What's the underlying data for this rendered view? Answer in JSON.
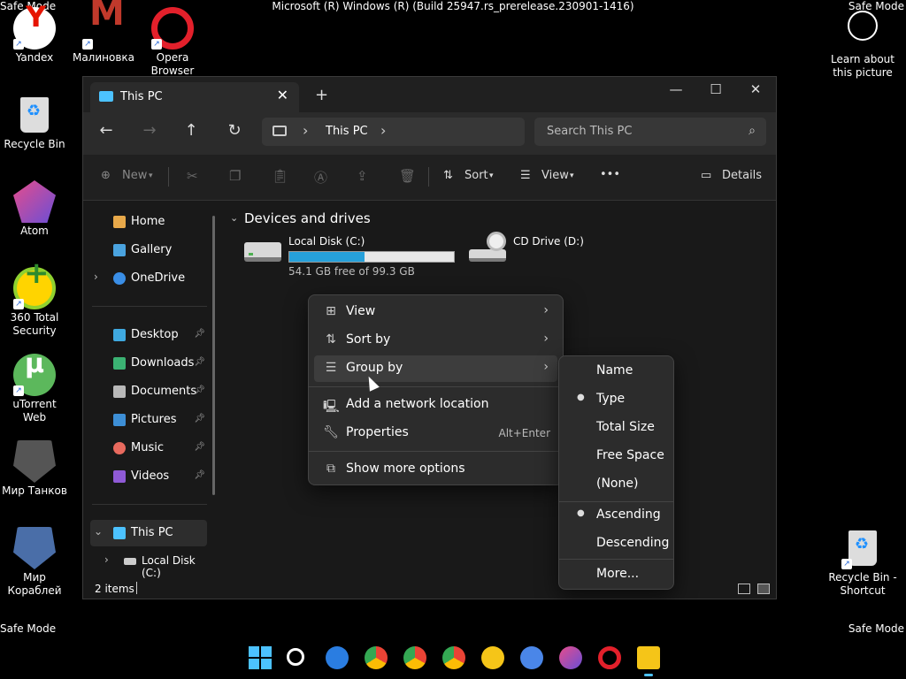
{
  "system": {
    "safe_mode_label": "Safe Mode",
    "build_string": "Microsoft (R) Windows (R) (Build 25947.rs_prerelease.230901-1416)"
  },
  "desktop_icons": [
    {
      "label": "Yandex",
      "icon": "yandex-icon",
      "color": "#ffffff"
    },
    {
      "label": "Малиновка",
      "icon": "malinovka-icon",
      "color": "#c0392b"
    },
    {
      "label": "Opera Browser",
      "icon": "opera-icon",
      "color": "#e3202b"
    },
    {
      "label": "Recycle Bin",
      "icon": "recycle-bin-icon",
      "color": "#c9c9c9"
    },
    {
      "label": "Atom",
      "icon": "atom-icon",
      "color": "#9b59d0"
    },
    {
      "label": "360 Total Security",
      "icon": "360-security-icon",
      "color": "#8fd12f"
    },
    {
      "label": "uTorrent Web",
      "icon": "utorrent-icon",
      "color": "#5cb85c"
    },
    {
      "label": "Мир Танков",
      "icon": "mir-tankov-icon",
      "color": "#777777"
    },
    {
      "label": "Мир Кораблей",
      "icon": "mir-korabley-icon",
      "color": "#4a6ea8"
    },
    {
      "label": "Learn about this picture",
      "icon": "learn-picture-icon",
      "color": "#ffffff"
    },
    {
      "label": "Recycle Bin - Shortcut",
      "icon": "recycle-bin-shortcut-icon",
      "color": "#c9c9c9"
    }
  ],
  "window": {
    "tab_title": "This PC",
    "new_tab": "+",
    "minimize": "—",
    "maximize": "☐",
    "close": "✕",
    "breadcrumb": "This PC",
    "search_placeholder": "Search This PC",
    "commands": {
      "new": "New",
      "sort": "Sort",
      "view": "View",
      "more": "•••",
      "details": "Details"
    }
  },
  "sidebar": {
    "items": [
      {
        "label": "Home",
        "icon": "home-icon",
        "color": "#e8a94a"
      },
      {
        "label": "Gallery",
        "icon": "gallery-icon",
        "color": "#4aa3df"
      },
      {
        "label": "OneDrive",
        "icon": "onedrive-icon",
        "color": "#3a8ee6"
      },
      {
        "label": "Desktop",
        "icon": "desktop-icon",
        "color": "#3fa9e0"
      },
      {
        "label": "Downloads",
        "icon": "downloads-icon",
        "color": "#3bb273"
      },
      {
        "label": "Documents",
        "icon": "documents-icon",
        "color": "#b8b8b8"
      },
      {
        "label": "Pictures",
        "icon": "pictures-icon",
        "color": "#3d8fd6"
      },
      {
        "label": "Music",
        "icon": "music-icon",
        "color": "#e86a5e"
      },
      {
        "label": "Videos",
        "icon": "videos-icon",
        "color": "#8f5ad6"
      },
      {
        "label": "This PC",
        "icon": "this-pc-icon",
        "color": "#4cc2ff"
      },
      {
        "label": "Local Disk (C:)",
        "icon": "local-disk-icon",
        "color": "#cccccc"
      }
    ]
  },
  "content": {
    "group_header": "Devices and drives",
    "drives": [
      {
        "name": "Local Disk (C:)",
        "free_text": "54.1 GB free of 99.3 GB",
        "used_fraction": 0.455
      },
      {
        "name": "CD Drive (D:)"
      }
    ]
  },
  "status": {
    "items_count": "2 items"
  },
  "context_menu": {
    "items": [
      {
        "label": "View",
        "icon": "view-icon"
      },
      {
        "label": "Sort by",
        "icon": "sort-icon"
      },
      {
        "label": "Group by",
        "icon": "group-icon"
      },
      {
        "label": "Add a network location",
        "icon": "network-location-icon"
      },
      {
        "label": "Properties",
        "icon": "properties-icon",
        "shortcut": "Alt+Enter"
      },
      {
        "label": "Show more options",
        "icon": "more-options-icon"
      }
    ]
  },
  "group_by_submenu": {
    "items": [
      {
        "label": "Name",
        "selected": false
      },
      {
        "label": "Type",
        "selected": true
      },
      {
        "label": "Total Size",
        "selected": false
      },
      {
        "label": "Free Space",
        "selected": false
      },
      {
        "label": "(None)",
        "selected": false
      },
      {
        "label": "Ascending",
        "selected": true
      },
      {
        "label": "Descending",
        "selected": false
      },
      {
        "label": "More...",
        "selected": false
      }
    ]
  },
  "taskbar": {
    "items": [
      {
        "icon": "start-icon",
        "color": "#4cc2ff"
      },
      {
        "icon": "search-icon",
        "color": "#ffffff"
      },
      {
        "icon": "edge-pre-icon",
        "color": "#2a7de1"
      },
      {
        "icon": "chrome-icon",
        "color": "#34a853"
      },
      {
        "icon": "chrome-beta-icon",
        "color": "#34a853"
      },
      {
        "icon": "chrome-dev-icon",
        "color": "#34a853"
      },
      {
        "icon": "chrome-canary-icon",
        "color": "#f5c518"
      },
      {
        "icon": "chromium-icon",
        "color": "#4a86e8"
      },
      {
        "icon": "atom-taskbar-icon",
        "color": "#9b59d0"
      },
      {
        "icon": "opera-taskbar-icon",
        "color": "#e3202b"
      },
      {
        "icon": "file-explorer-icon",
        "color": "#f5c518"
      }
    ]
  }
}
